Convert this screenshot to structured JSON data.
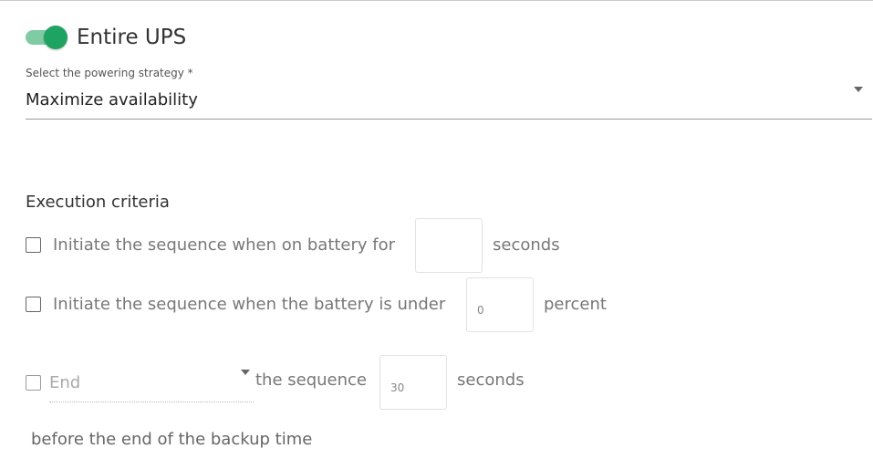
{
  "header": {
    "toggle_label": "Entire UPS",
    "toggle_on": true
  },
  "strategy": {
    "label": "Select the powering strategy *",
    "value": "Maximize availability"
  },
  "criteria": {
    "title": "Execution criteria",
    "on_battery": {
      "checked": false,
      "prefix": "Initiate the sequence when on battery for",
      "value": "",
      "suffix": "seconds"
    },
    "battery_under": {
      "checked": false,
      "prefix": "Initiate the sequence when the battery is under",
      "value": "0",
      "suffix": "percent"
    },
    "end": {
      "checked": false,
      "select_value": "End",
      "middle": "the sequence",
      "value": "30",
      "suffix": "seconds",
      "trailer": "before the end of the backup time"
    }
  },
  "colors": {
    "accent": "#1fa363",
    "accent_track": "#7fcba4"
  }
}
